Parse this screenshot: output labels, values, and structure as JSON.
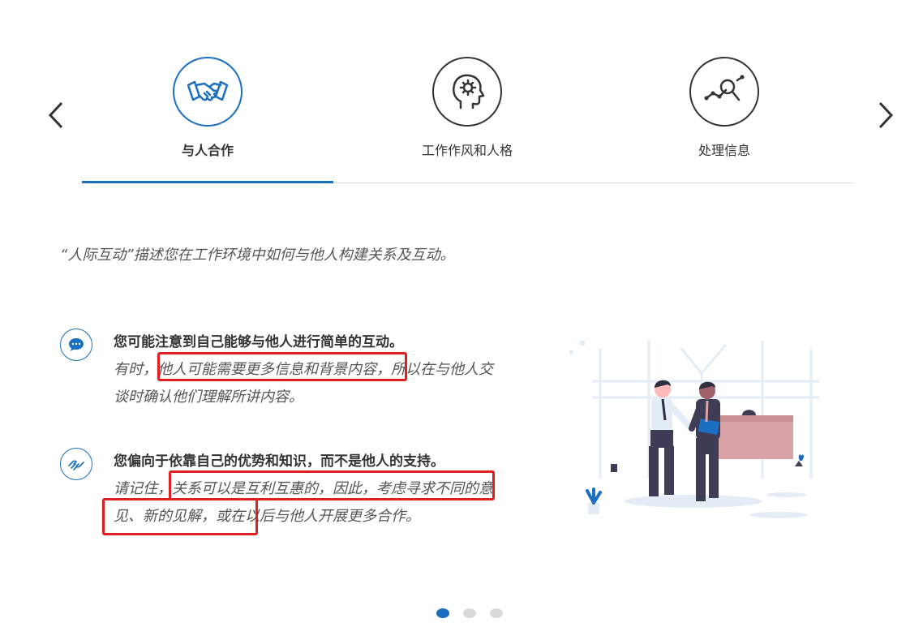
{
  "tabs": [
    {
      "label": "与人合作",
      "icon": "handshake-icon",
      "active": true
    },
    {
      "label": "工作作风和人格",
      "icon": "head-gear-icon",
      "active": false
    },
    {
      "label": "处理信息",
      "icon": "magnifier-chart-icon",
      "active": false
    }
  ],
  "intro": "“人际互动”描述您在工作环境中如何与他人构建关系及互动。",
  "items": [
    {
      "icon": "speech-bubble-icon",
      "title": "您可能注意到自己能够与他人进行简单的互动。",
      "body": "有时，他人可能需要更多信息和背景内容，所以在与他人交谈时确认他们理解所讲内容。"
    },
    {
      "icon": "hands-icon",
      "title": "您偏向于依靠自己的优势和知识，而不是他人的支持。",
      "body": "请记住，关系可以是互利互惠的，因此，考虑寻求不同的意见、新的见解，或在以后与他人开展更多合作。"
    }
  ],
  "pagination": {
    "count": 3,
    "active": 1
  },
  "colors": {
    "accent": "#1a6fc0",
    "highlight": "#e02020",
    "text": "#333333",
    "muted": "#555555"
  }
}
